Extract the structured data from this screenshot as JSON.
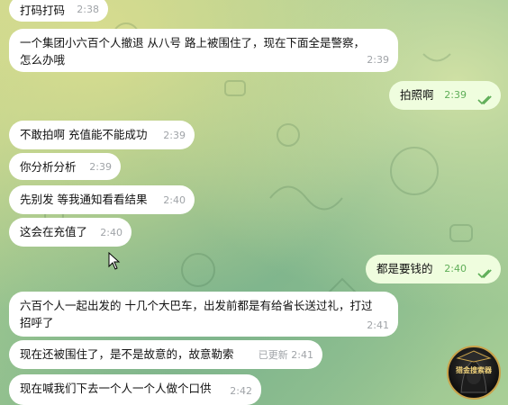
{
  "messages": [
    {
      "text": "打码打码",
      "time": "2:38"
    },
    {
      "text": "一个集团小六百个人撤退 从八号 路上被围住了，现在下面全是警察，\n怎么办哦",
      "time": "2:39"
    },
    {
      "text": "拍照啊",
      "time": "2:39"
    },
    {
      "text": "不敢拍啊 充值能不能成功",
      "time": "2:39"
    },
    {
      "text": "你分析分析",
      "time": "2:39"
    },
    {
      "text": "先别发 等我通知看看结果",
      "time": "2:40"
    },
    {
      "text": "这会在充值了",
      "time": "2:40"
    },
    {
      "text": "都是要钱的",
      "time": "2:40"
    },
    {
      "text": "六百个人一起出发的 十几个大巴车，出发前都是有给省长送过礼，打过\n招呼了",
      "time": "2:41"
    },
    {
      "text": "现在还被围住了，是不是故意的，故意勒索",
      "time": "已更新 2:41"
    },
    {
      "text": "现在喊我们下去一个人一个人做个口供",
      "time": "2:42"
    }
  ],
  "watermark": {
    "text": "猎金搜索器"
  },
  "colors": {
    "incoming": "#ffffff",
    "outgoing": "#effdde",
    "read_check": "#5fae58"
  }
}
